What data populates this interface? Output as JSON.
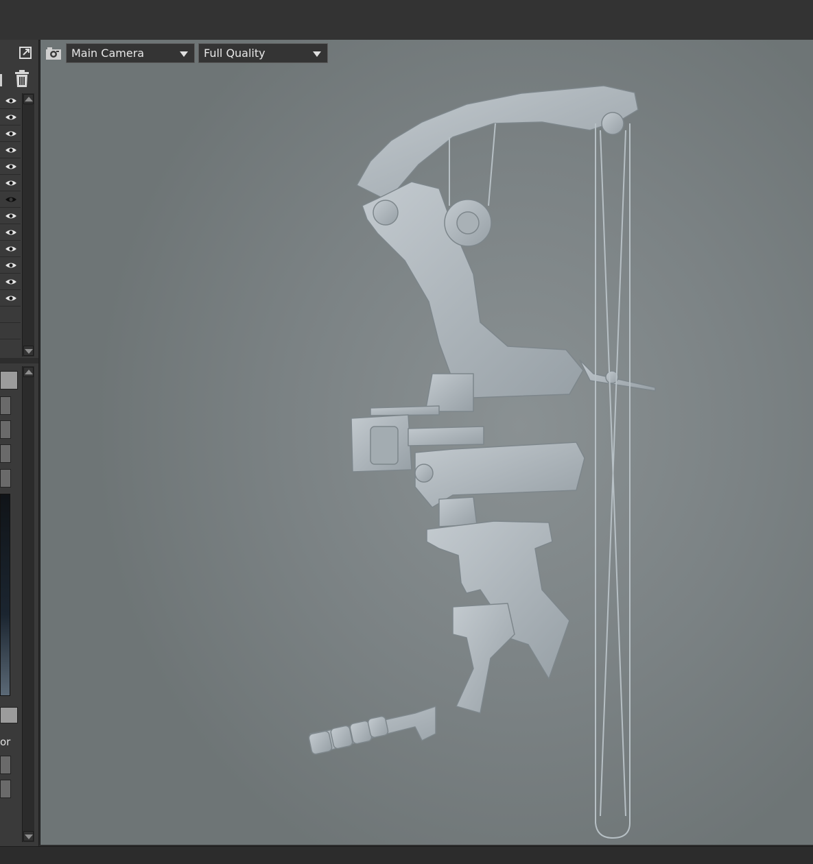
{
  "viewport_toolbar": {
    "camera_select": "Main Camera",
    "quality_select": "Full Quality"
  },
  "left_panel": {
    "visibility_rows": 13,
    "truncated_label": "or"
  },
  "icons": {
    "popout": "popout-icon",
    "trash": "trash-icon",
    "eye": "eye-icon",
    "camera": "camera-icon"
  },
  "colors": {
    "viewport_bg": "#7b8284",
    "model": "#aeb6bb",
    "chrome": "#333333"
  }
}
